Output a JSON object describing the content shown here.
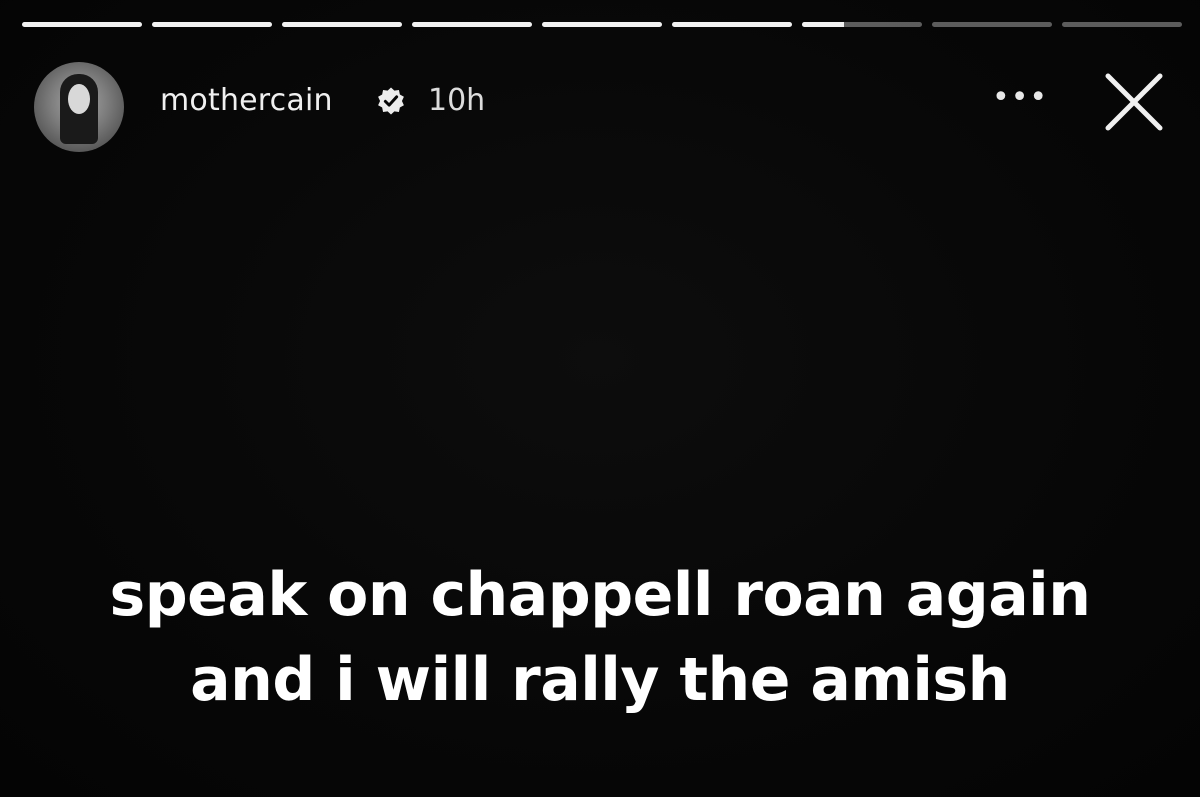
{
  "story": {
    "username": "mothercain",
    "time": "10h",
    "more_label": "•••",
    "progress": {
      "segments": 9,
      "completed": 6,
      "current_fill": 0.35
    },
    "caption": {
      "line1": "speak on chappell roan again",
      "line2": "and i will rally the amish"
    },
    "icons": {
      "verified": "verified-badge-icon",
      "close": "close-icon",
      "more": "more-options-icon"
    },
    "colors": {
      "background": "#060606",
      "text": "#ffffff",
      "progress_track": "rgba(255,255,255,0.35)",
      "progress_fill": "#f2f2f2"
    }
  }
}
